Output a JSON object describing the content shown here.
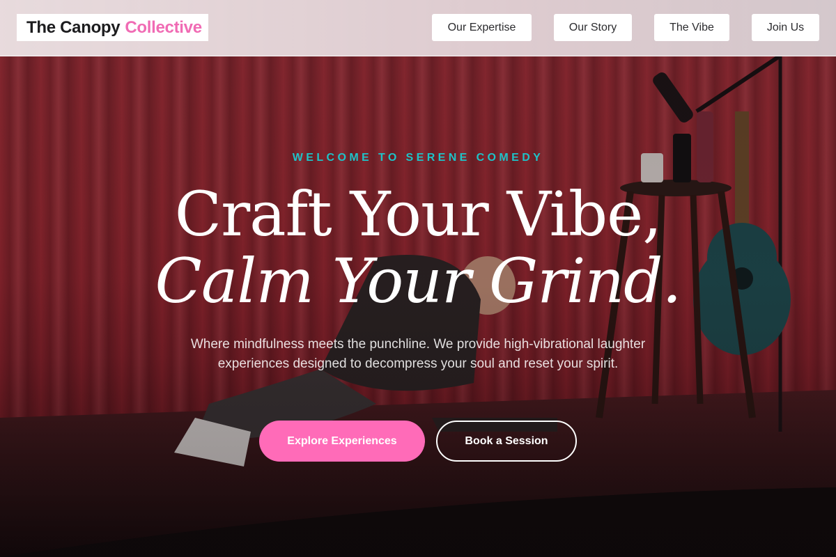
{
  "header": {
    "logo_primary": "The Canopy",
    "logo_accent": "Collective",
    "nav": [
      {
        "label": "Our Expertise"
      },
      {
        "label": "Our Story"
      },
      {
        "label": "The Vibe"
      },
      {
        "label": "Join Us"
      }
    ]
  },
  "hero": {
    "eyebrow": "WELCOME TO SERENE COMEDY",
    "headline_line1": "Craft Your Vibe,",
    "headline_line2": "Calm Your Grind.",
    "lede": "Where mindfulness meets the punchline. We provide high-vibrational laughter experiences designed to decompress your soul and reset your spirit.",
    "cta_primary": "Explore Experiences",
    "cta_secondary": "Book a Session",
    "background_image": "comedian-on-stage-photo"
  },
  "colors": {
    "accent_pink": "#ff6bb8",
    "logo_pink": "#f06bb4",
    "eyebrow_teal": "#1ec3c8"
  }
}
